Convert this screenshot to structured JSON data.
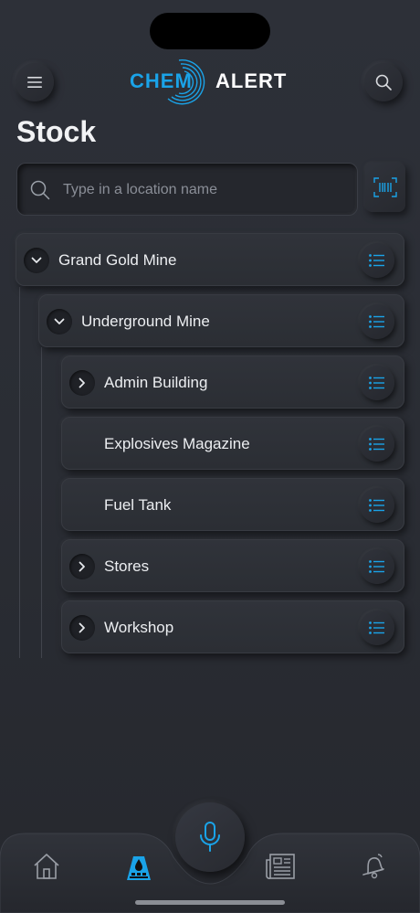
{
  "app": {
    "logo_left": "CHEM",
    "logo_right": "ALERT"
  },
  "header": {
    "menu_icon": "hamburger-menu-icon",
    "search_icon": "search-icon"
  },
  "page": {
    "title": "Stock"
  },
  "search": {
    "placeholder": "Type in a location name",
    "value": ""
  },
  "tree": {
    "root": {
      "label": "Grand Gold Mine",
      "expanded": true
    },
    "site": {
      "label": "Underground Mine",
      "expanded": true
    },
    "children": [
      {
        "label": "Admin Building",
        "has_children": true
      },
      {
        "label": "Explosives Magazine",
        "has_children": false
      },
      {
        "label": "Fuel Tank",
        "has_children": false
      },
      {
        "label": "Stores",
        "has_children": true
      },
      {
        "label": "Workshop",
        "has_children": true
      }
    ]
  },
  "bottom_nav": {
    "items": [
      "home-icon",
      "stock-icon",
      "news-icon",
      "alerts-icon"
    ],
    "active": "stock-icon",
    "mic_icon": "microphone-icon"
  },
  "colors": {
    "accent": "#1aa3e8",
    "background": "#2b2e35"
  }
}
